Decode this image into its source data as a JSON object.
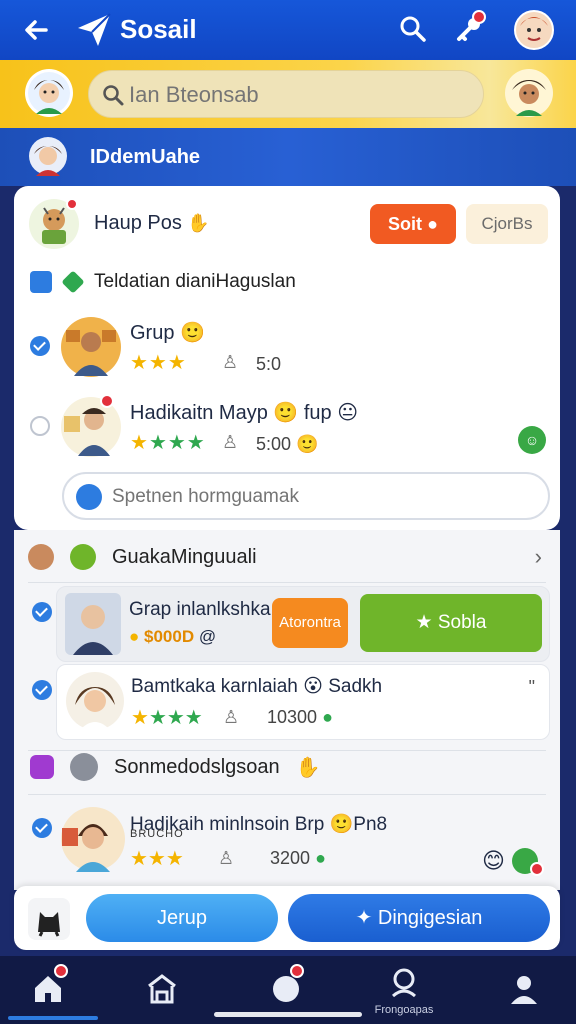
{
  "app": {
    "title": "Sosail",
    "brand_color": "#1657d9",
    "accent_yellow": "#f7c21a"
  },
  "topbar": {
    "back_icon": "arrow-left-icon",
    "logo_icon": "paper-plane-logo",
    "search_icon": "search-icon",
    "key_icon": "key-icon",
    "avatar_icon": "user-avatar"
  },
  "search": {
    "placeholder": "Ian Bteonsab"
  },
  "group": {
    "title": "IDdemUahe"
  },
  "card": {
    "title": "Haup Pos",
    "buttons": {
      "sort": "Soit",
      "secondary": "CjorBs"
    },
    "subheading": "Teldatian dianiHaguslan",
    "members": [
      {
        "name": "Grup",
        "stars": "★★★",
        "figure_icon": "person-icon",
        "score": "5:0",
        "checked": true
      },
      {
        "name": "Hadikaitn Mayp",
        "suffix": "fup",
        "stars": "★★★★",
        "figure_icon": "person-icon",
        "score": "5:00",
        "checked": false
      }
    ],
    "comment_placeholder": "Spetnen hormguamak"
  },
  "section2": {
    "title": "GuakaMinguuali",
    "rows": [
      {
        "name": "Grap inlanlkshka",
        "amount": "$000D",
        "amount_suffix": "@",
        "tag": "Atorontra",
        "action": "Sobla",
        "checked": true
      },
      {
        "name": "Bamtkaka karnlaiah",
        "extra": "Sadkh",
        "stars": "★★★★",
        "figure_icon": "person-icon",
        "score": "10300",
        "more": "\"",
        "checked": true
      }
    ],
    "group2_title": "Sonmedodslgsoan",
    "row3": {
      "name": "Hadikaih minlnsoin Brp",
      "extra": "Pn8",
      "subtitle": "BRUCHO",
      "stars": "★★★",
      "figure_icon": "person-icon",
      "score": "3200",
      "checked": true
    }
  },
  "actions": {
    "left": "Jerup",
    "right": "Dingigesian"
  },
  "nav": {
    "items": [
      {
        "icon": "home-icon",
        "label": ""
      },
      {
        "icon": "store-icon",
        "label": ""
      },
      {
        "icon": "chat-bubble-icon",
        "label": ""
      },
      {
        "icon": "profile-search-icon",
        "label": "Frongoapas"
      },
      {
        "icon": "person-icon",
        "label": ""
      }
    ]
  }
}
